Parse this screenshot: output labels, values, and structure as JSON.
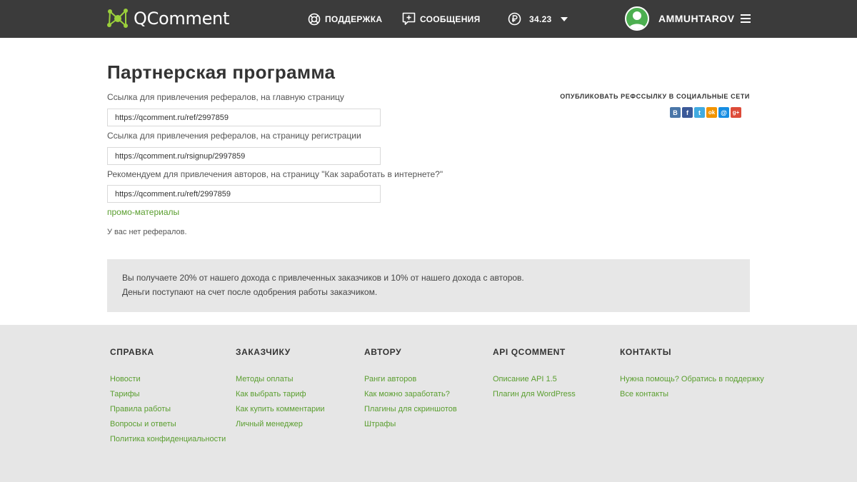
{
  "header": {
    "logo_text": "QComment",
    "support_label": "ПОДДЕРЖКА",
    "messages_label": "СООБЩЕНИЯ",
    "balance": "34.23",
    "username": "AMMUHTAROV"
  },
  "main": {
    "title": "Партнерская программа",
    "fields": [
      {
        "label": "Ссылка для привлечения рефералов, на главную страницу",
        "value": "https://qcomment.ru/ref/2997859"
      },
      {
        "label": "Ссылка для привлечения рефералов, на страницу регистрации",
        "value": "https://qcomment.ru/rsignup/2997859"
      },
      {
        "label": "Рекомендуем для привлечения авторов, на страницу \"Как заработать в интернете?\"",
        "value": "https://qcomment.ru/reft/2997859"
      }
    ],
    "promo_link": "промо-материалы",
    "no_referrals": "У вас нет рефералов.",
    "share_title": "ОПУБЛИКОВАТЬ РЕФССЫЛКУ В СОЦИАЛЬНЫЕ СЕТИ",
    "share_icons": [
      {
        "name": "vk-icon",
        "glyph": "В",
        "color": "#4a76a8"
      },
      {
        "name": "facebook-icon",
        "glyph": "f",
        "color": "#3b5998"
      },
      {
        "name": "twitter-icon",
        "glyph": "t",
        "color": "#41abe1"
      },
      {
        "name": "odnoklassniki-icon",
        "glyph": "ok",
        "color": "#f29400"
      },
      {
        "name": "mailru-icon",
        "glyph": "@",
        "color": "#168de2"
      },
      {
        "name": "googleplus-icon",
        "glyph": "g+",
        "color": "#dd4b39"
      }
    ],
    "info_lines": [
      "Вы получаете 20% от нашего дохода с привлеченных заказчиков и 10% от нашего дохода с авторов.",
      "Деньги поступают на счет после одобрения работы заказчиком."
    ]
  },
  "footer": {
    "columns": [
      {
        "title": "СПРАВКА",
        "links": [
          "Новости",
          "Тарифы",
          "Правила работы",
          "Вопросы и ответы",
          "Политика конфиденциальности"
        ]
      },
      {
        "title": "ЗАКАЗЧИКУ",
        "links": [
          "Методы оплаты",
          "Как выбрать тариф",
          "Как купить комментарии",
          "Личный менеджер"
        ]
      },
      {
        "title": "АВТОРУ",
        "links": [
          "Ранги авторов",
          "Как можно заработать?",
          "Плагины для скриншотов",
          "Штрафы"
        ]
      },
      {
        "title": "API QCOMMENT",
        "links": [
          "Описание API 1.5",
          "Плагин для WordPress"
        ]
      },
      {
        "title": "КОНТАКТЫ",
        "links": [
          "Нужна помощь? Обратись в поддержку",
          "Все контакты"
        ]
      }
    ]
  },
  "colors": {
    "header_bg": "#3b3b3b",
    "accent_green": "#5a9e2f",
    "info_bg": "#e7e7e7",
    "footer_bg": "#e6e6e6"
  }
}
